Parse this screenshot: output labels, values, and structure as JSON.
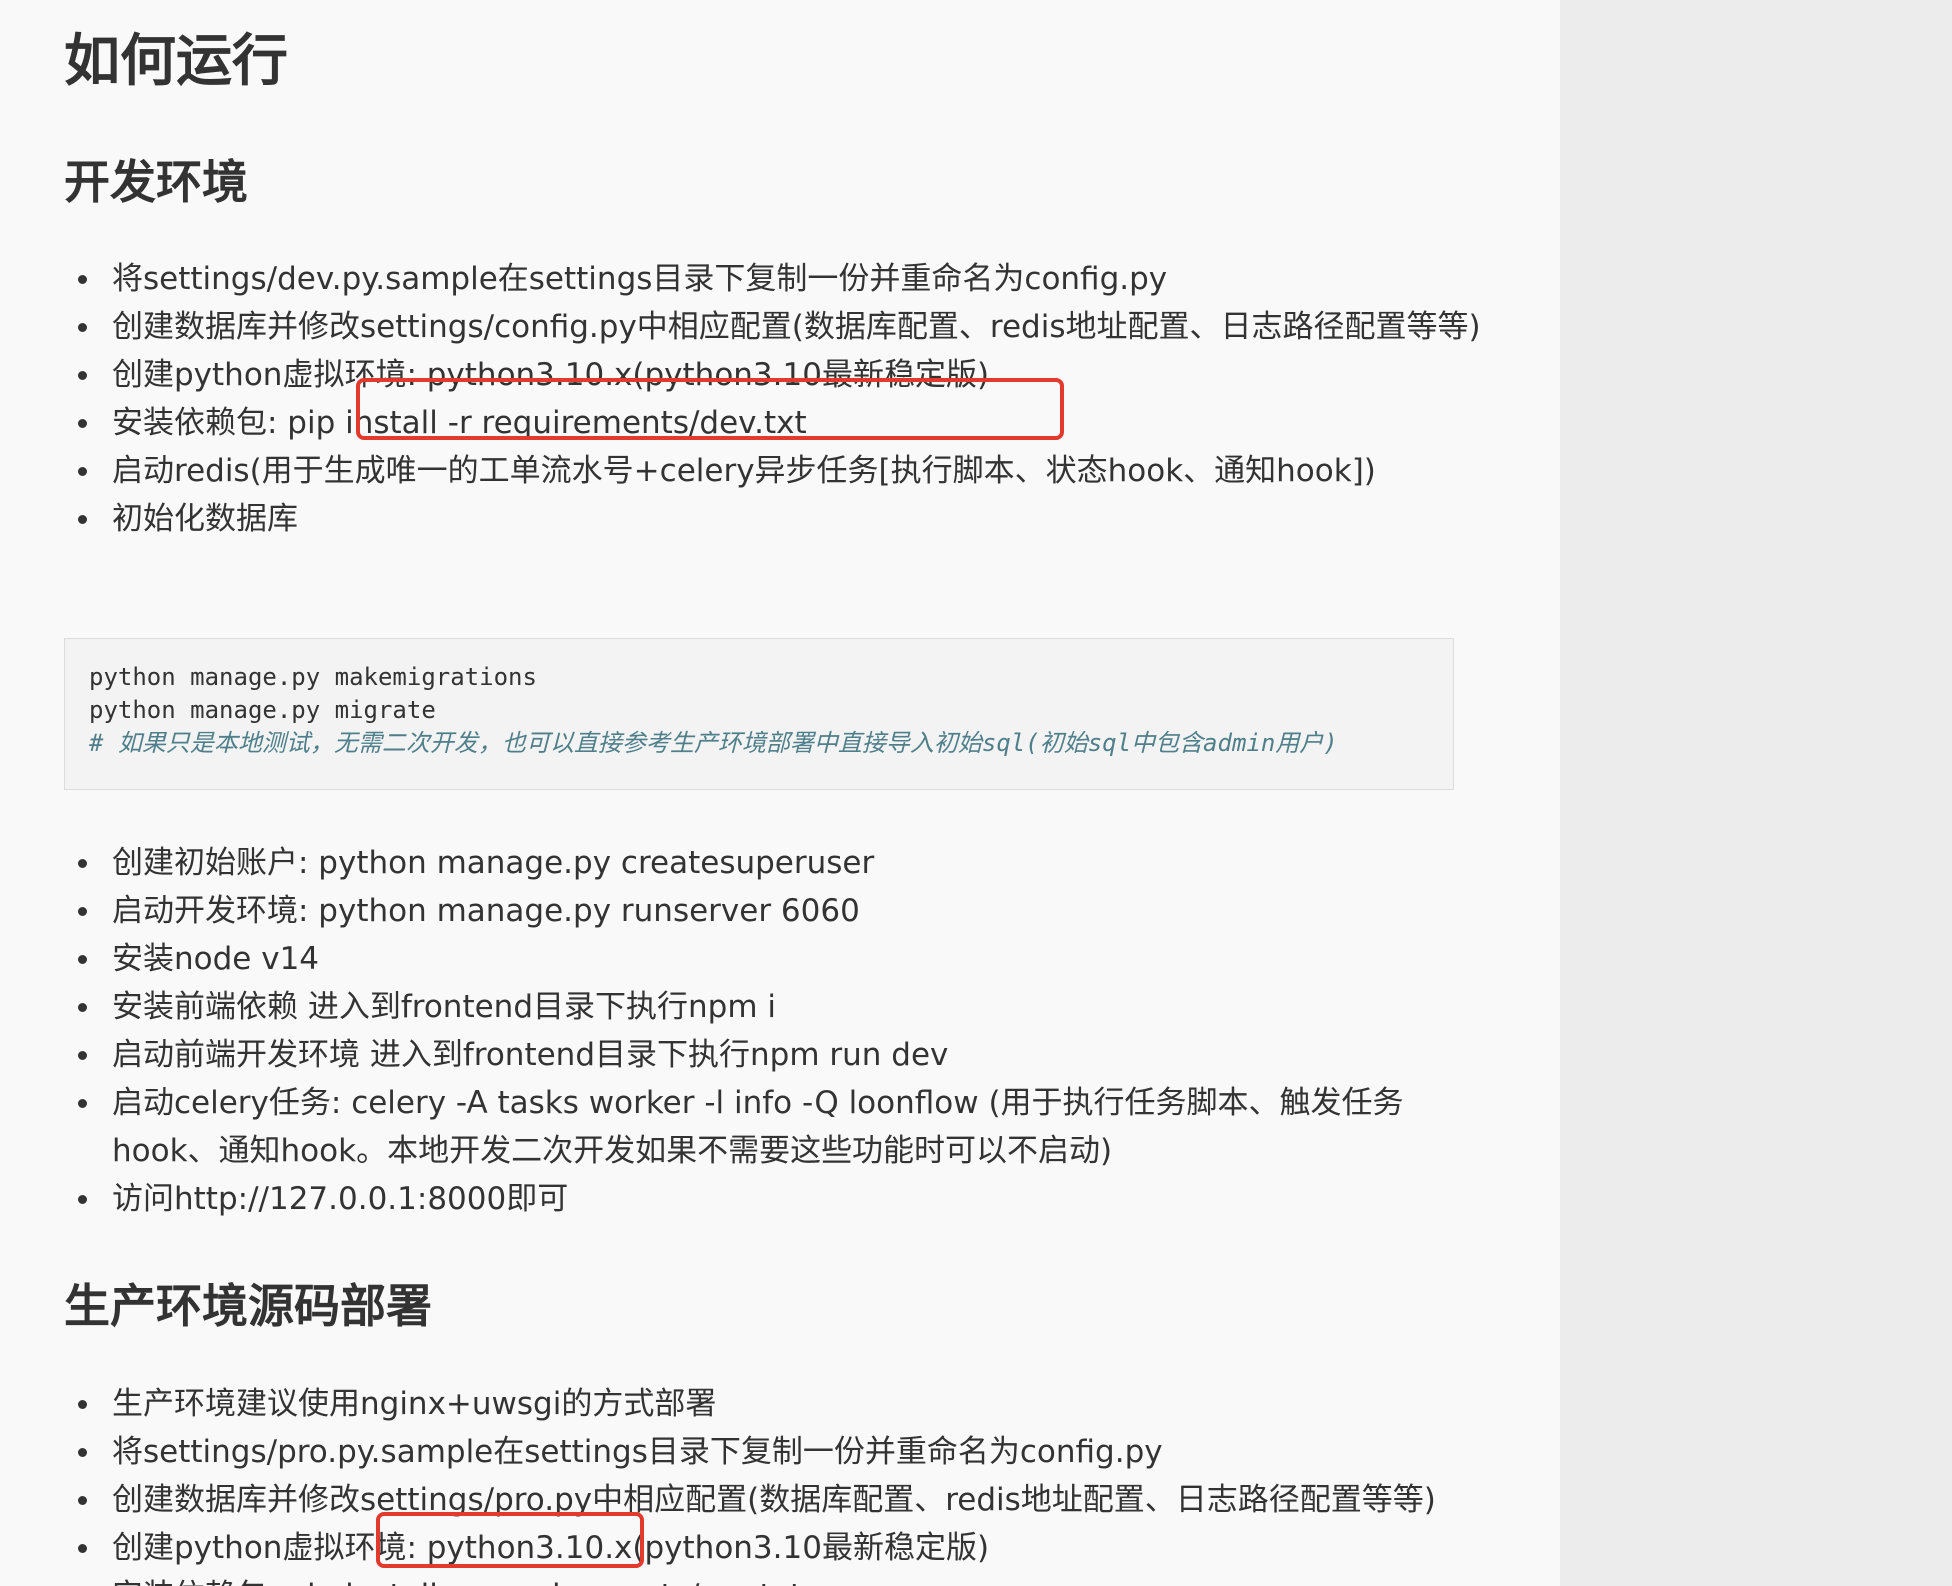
{
  "title": "如何运行",
  "dev_section": {
    "heading": "开发环境",
    "items_a": [
      "将settings/dev.py.sample在settings目录下复制一份并重命名为config.py",
      "创建数据库并修改settings/config.py中相应配置(数据库配置、redis地址配置、日志路径配置等等)",
      "创建python虚拟环境: python3.10.x(python3.10最新稳定版)",
      "安装依赖包: pip install -r requirements/dev.txt",
      "启动redis(用于生成唯一的工单流水号+celery异步任务[执行脚本、状态hook、通知hook])",
      "初始化数据库"
    ],
    "code": {
      "line1": "python manage.py makemigrations",
      "line2": "python manage.py migrate",
      "comment": "# 如果只是本地测试，无需二次开发，也可以直接参考生产环境部署中直接导入初始sql(初始sql中包含admin用户)"
    },
    "items_b": [
      "创建初始账户: python manage.py createsuperuser",
      "启动开发环境: python manage.py runserver 6060",
      "安装node v14",
      "安装前端依赖 进入到frontend目录下执行npm i",
      "启动前端开发环境 进入到frontend目录下执行npm run dev",
      "启动celery任务: celery -A tasks worker -l info -Q loonflow (用于执行任务脚本、触发任务hook、通知hook。本地开发二次开发如果不需要这些功能时可以不启动)",
      "访问http://127.0.0.1:8000即可"
    ]
  },
  "prod_section": {
    "heading": "生产环境源码部署",
    "items": [
      "生产环境建议使用nginx+uwsgi的方式部署",
      "将settings/pro.py.sample在settings目录下复制一份并重命名为config.py",
      "创建数据库并修改settings/pro.py中相应配置(数据库配置、redis地址配置、日志路径配置等等)",
      "创建python虚拟环境: python3.10.x(python3.10最新稳定版)",
      "安装依赖包: pip install -r requirements/pro.txt"
    ]
  },
  "colors": {
    "annotation_red": "#e23a2d",
    "code_comment": "#4f7f8a"
  }
}
